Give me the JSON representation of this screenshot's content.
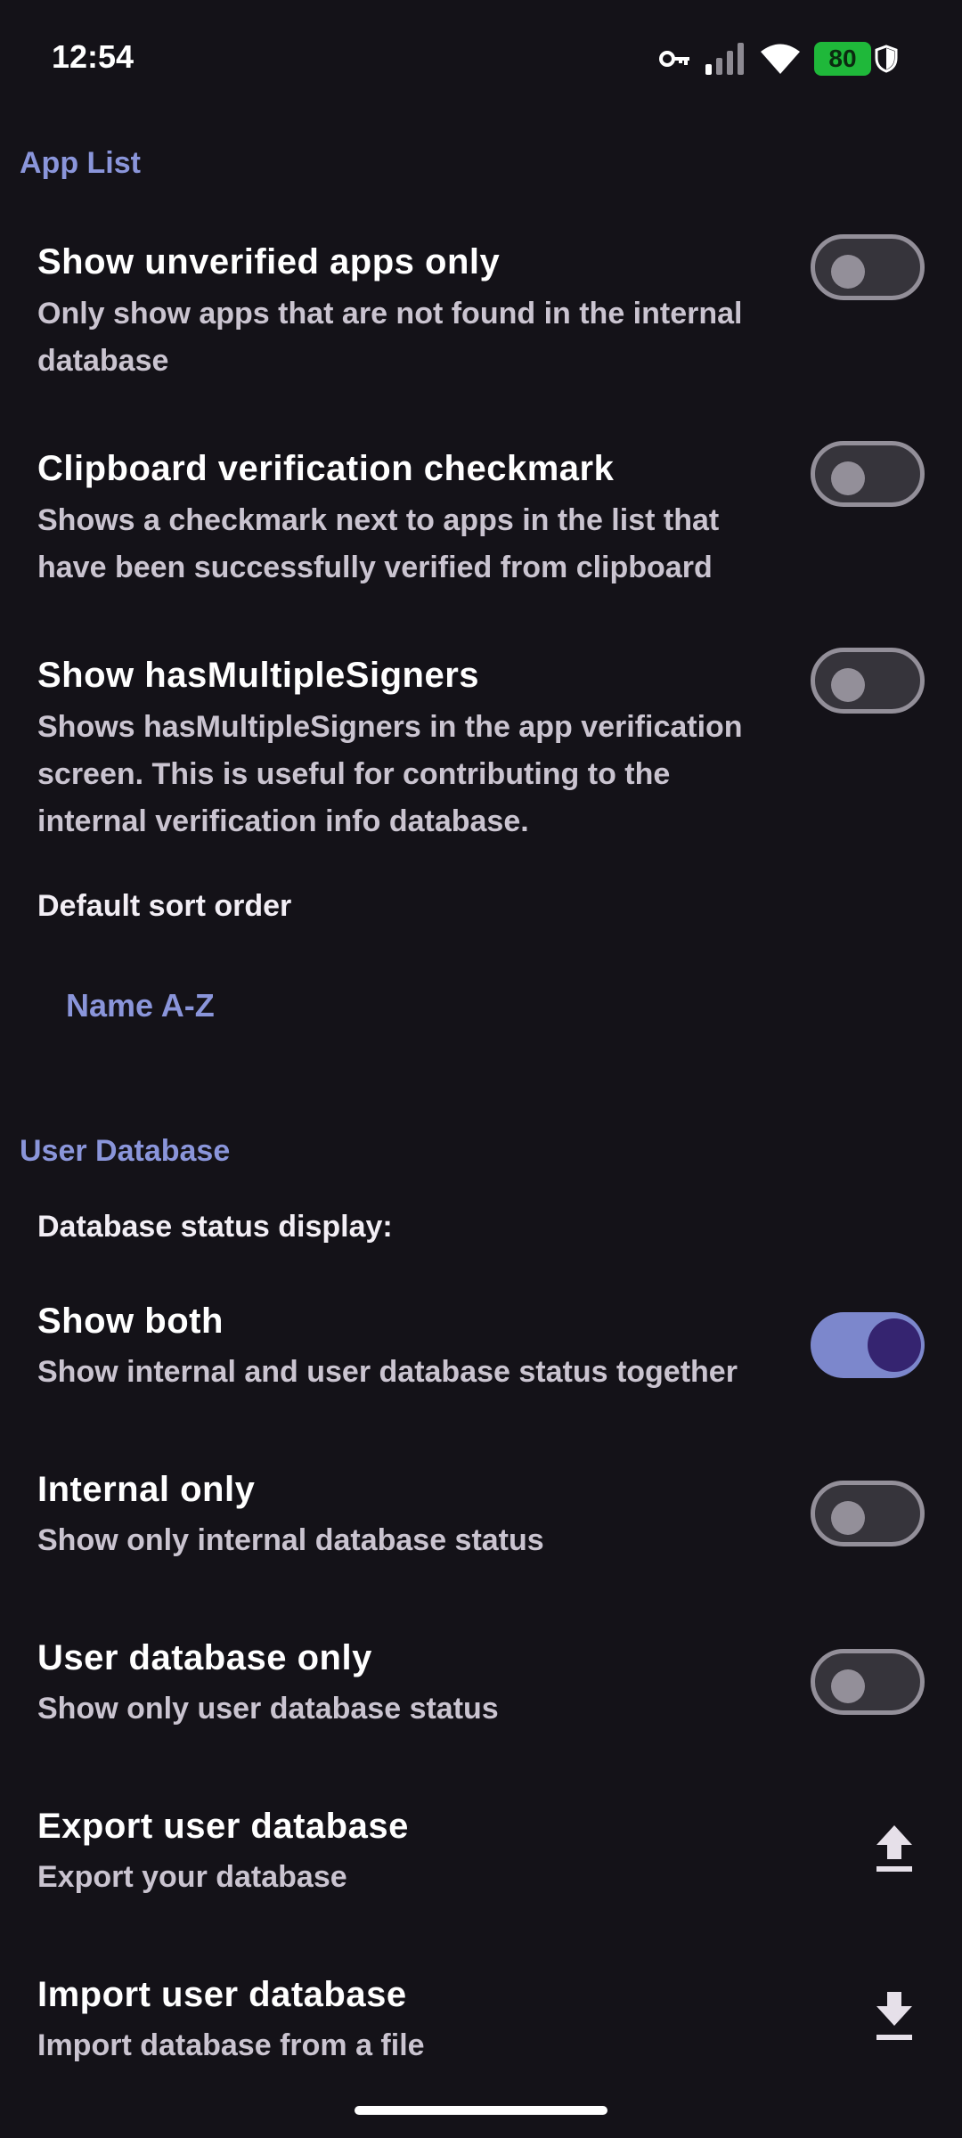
{
  "status_bar": {
    "time": "12:54",
    "battery_level": "80",
    "icons": [
      "vpn-key-icon",
      "signal-icon",
      "wifi-icon",
      "battery-icon",
      "shield-icon"
    ]
  },
  "colors": {
    "background": "#141218",
    "accent": "#8a95da",
    "switch_on_track": "#7c87cc",
    "switch_on_thumb": "#352470",
    "battery": "#1fb83a"
  },
  "app_list": {
    "header": "App List",
    "show_unverified": {
      "title": "Show unverified apps only",
      "subtitle": "Only show apps that are not found in the internal database",
      "enabled": false
    },
    "clipboard_checkmark": {
      "title": "Clipboard verification checkmark",
      "subtitle": "Shows a checkmark next to apps in the list that have been successfully verified from clipboard",
      "enabled": false
    },
    "show_multiple_signers": {
      "title": "Show hasMultipleSigners",
      "subtitle": "Shows hasMultipleSigners in the app verification screen. This is useful for contributing to the internal verification info database.",
      "enabled": false
    },
    "sort_order": {
      "label": "Default sort order",
      "value": "Name A-Z"
    }
  },
  "user_database": {
    "header": "User Database",
    "status_display_label": "Database status display:",
    "show_both": {
      "title": "Show both",
      "subtitle": "Show internal and user database status together",
      "enabled": true
    },
    "internal_only": {
      "title": "Internal only",
      "subtitle": "Show only internal database status",
      "enabled": false
    },
    "user_only": {
      "title": "User database only",
      "subtitle": "Show only user database status",
      "enabled": false
    },
    "export": {
      "title": "Export user database",
      "subtitle": "Export your database",
      "icon": "upload-icon"
    },
    "import": {
      "title": "Import user database",
      "subtitle": "Import database from a file",
      "icon": "download-icon"
    }
  }
}
